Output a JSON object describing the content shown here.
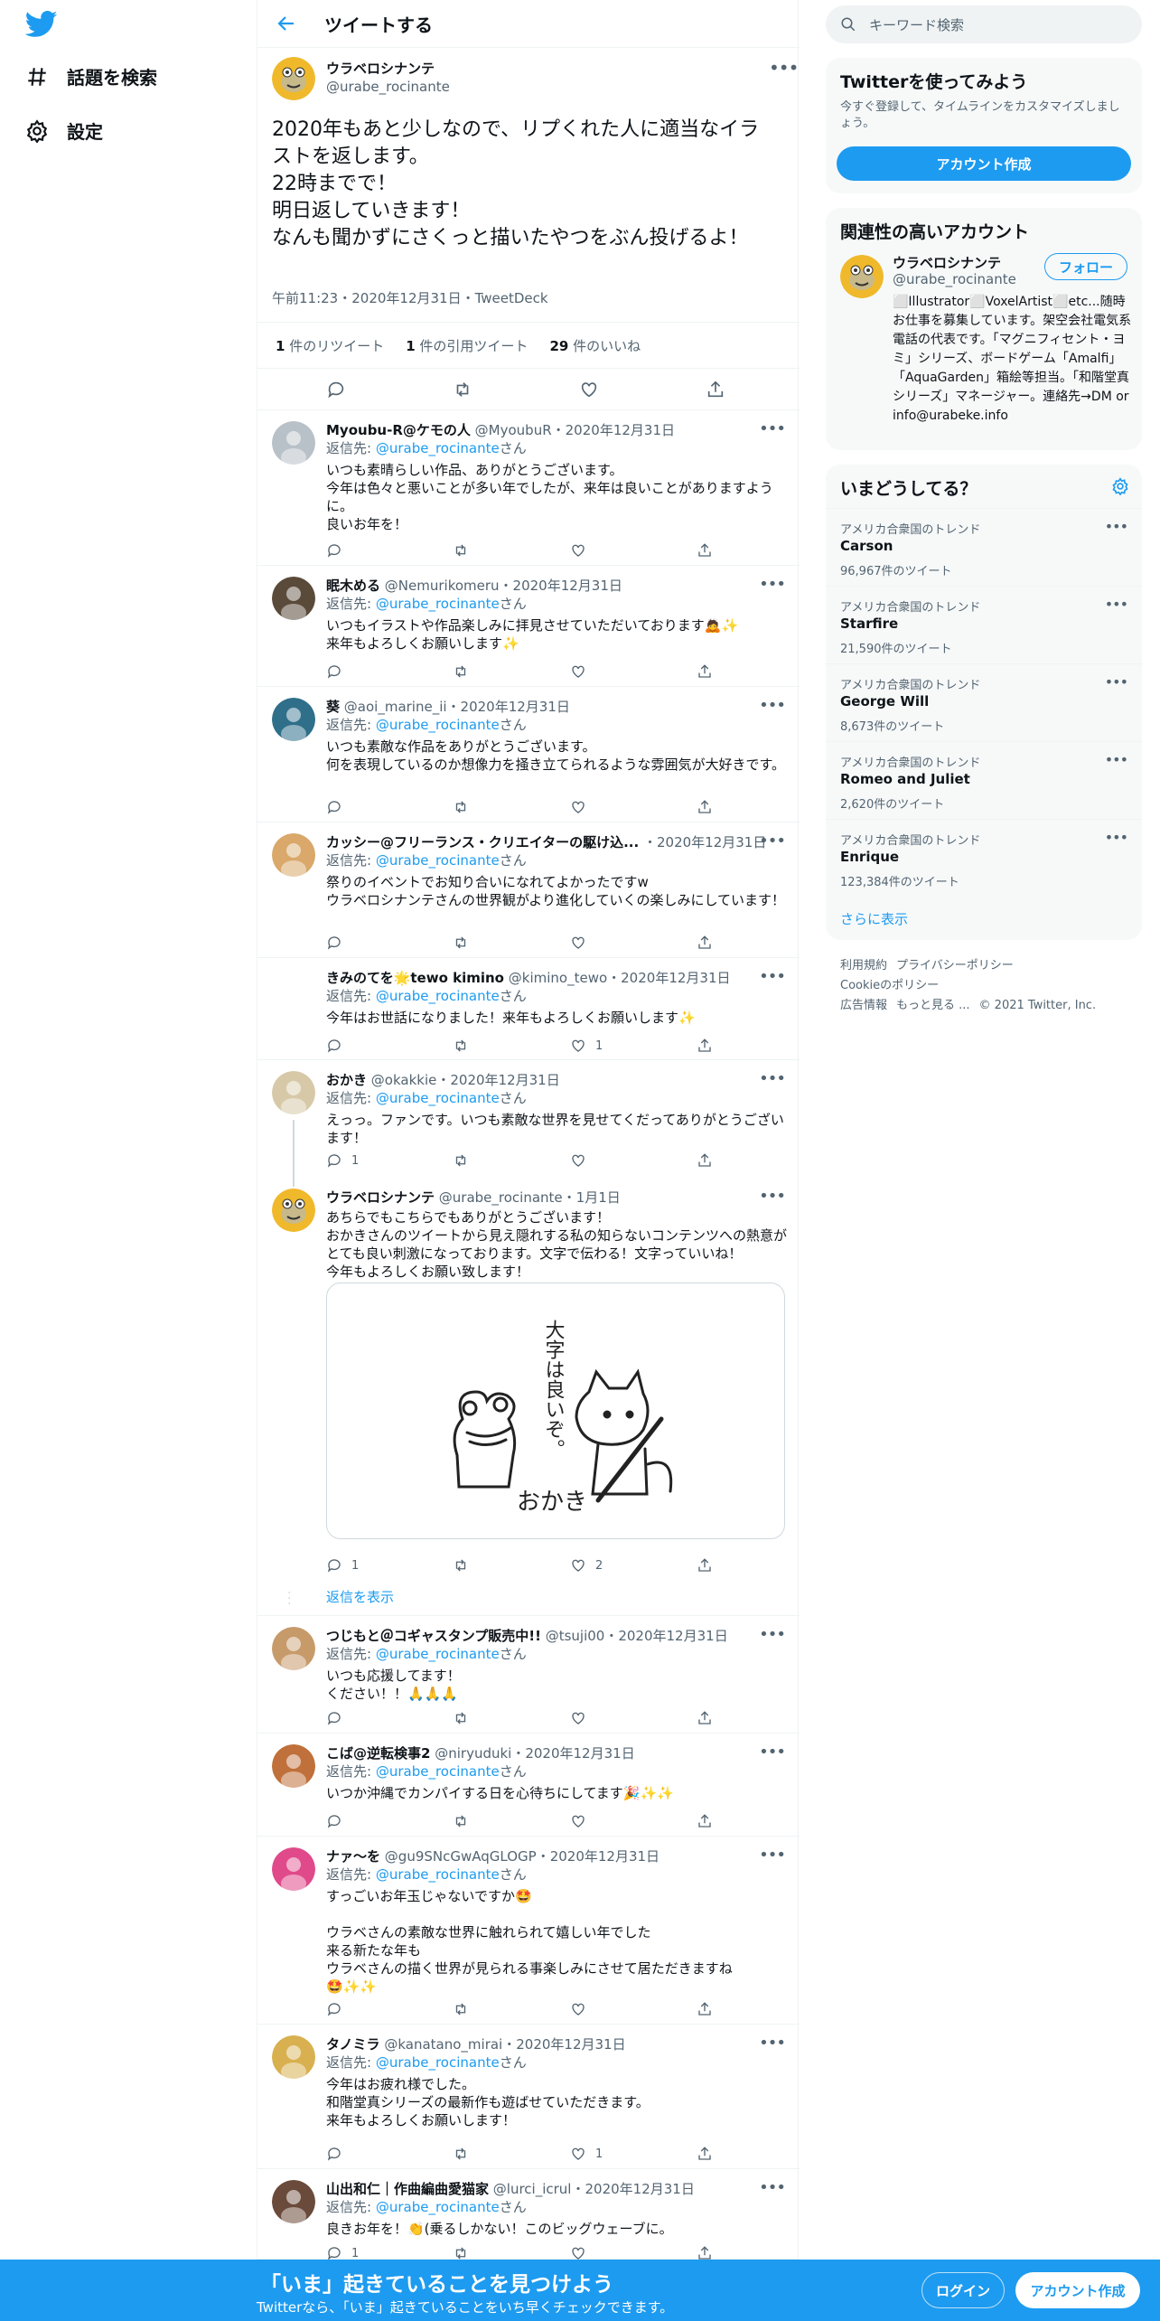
{
  "nav": {
    "explore": "話題を検索",
    "settings": "設定"
  },
  "header": {
    "title": "ツイートする"
  },
  "focus": {
    "name": "ウラベロシナンテ",
    "handle": "@urabe_rocinante",
    "text": "2020年もあと少しなので、リプくれた人に適当なイラストを返します。\n22時までで！\n明日返していきます！\nなんも聞かずにさくっと描いたやつをぶん投げるよ！",
    "meta": "午前11:23・2020年12月31日・TweetDeck",
    "retweets_count": "1",
    "retweets_label": " 件のリツイート",
    "quotes_count": "1",
    "quotes_label": " 件の引用ツイート",
    "likes_count": "29",
    "likes_label": " 件のいいね"
  },
  "reply_to_prefix": "返信先: ",
  "reply_to_suffix": "さん",
  "replies": [
    {
      "name": "Myoubu-R@ケモの人",
      "handle": "@MyoubuR",
      "date": "・2020年12月31日",
      "to": "@urabe_rocinante",
      "text": "いつも素晴らしい作品、ありがとうございます。\n今年は色々と悪いことが多い年でしたが、来年は良いことがありますように。\n良いお年を！",
      "reply_count": "",
      "rt_count": "",
      "like_count": ""
    },
    {
      "name": "眠木める",
      "handle": "@Nemurikomeru",
      "date": "・2020年12月31日",
      "to": "@urabe_rocinante",
      "text": "いつもイラストや作品楽しみに拝見させていただいております🙇✨\n来年もよろしくお願いします✨",
      "reply_count": "",
      "rt_count": "",
      "like_count": ""
    },
    {
      "name": "葵",
      "handle": "@aoi_marine_ii",
      "date": "・2020年12月31日",
      "to": "@urabe_rocinante",
      "text": "いつも素敵な作品をありがとうございます。\n何を表現しているのか想像力を掻き立てられるような雰囲気が大好きです。",
      "reply_count": "",
      "rt_count": "",
      "like_count": ""
    },
    {
      "name": "カッシー@フリーランス・クリエイターの駆け込...",
      "handle": "",
      "date": "・2020年12月31日",
      "to": "@urabe_rocinante",
      "text": "祭りのイベントでお知り合いになれてよかったですw\nウラベロシナンテさんの世界観がより進化していくの楽しみにしています！",
      "reply_count": "",
      "rt_count": "",
      "like_count": ""
    },
    {
      "name": "きみのてを🌟tewo kimino",
      "handle": "@kimino_tewo",
      "date": "・2020年12月31日",
      "to": "@urabe_rocinante",
      "text": "今年はお世話になりました！来年もよろしくお願いします✨",
      "reply_count": "",
      "rt_count": "",
      "like_count": "1"
    },
    {
      "name": "おかき",
      "handle": "@okakkie",
      "date": "・2020年12月31日",
      "to": "@urabe_rocinante",
      "text": "えっっ。ファンです。いつも素敵な世界を見せてくだってありがとうございます！",
      "reply_count": "1",
      "rt_count": "",
      "like_count": ""
    },
    {
      "name": "ウラベロシナンテ",
      "handle": "@urabe_rocinante",
      "date": "・1月1日",
      "to": "",
      "text": "あちらでもこちらでもありがとうございます！\nおかきさんのツイートから見え隠れする私の知らないコンテンツへの熱意がとても良い刺激になっております。文字で伝わる！文字っていいね！\n今年もよろしくお願い致します！",
      "reply_count": "1",
      "rt_count": "",
      "like_count": "2"
    },
    {
      "name": "つじもと＠コギャスタンプ販売中!!",
      "handle": "@tsuji00",
      "date": "・2020年12月31日",
      "to": "@urabe_rocinante",
      "text": "いつも応援してます！\nください！！🙏🙏🙏",
      "reply_count": "",
      "rt_count": "",
      "like_count": ""
    },
    {
      "name": "こば@逆転検事2",
      "handle": "@niryuduki",
      "date": "・2020年12月31日",
      "to": "@urabe_rocinante",
      "text": "いつか沖縄でカンパイする日を心待ちにしてます🎉✨✨",
      "reply_count": "",
      "rt_count": "",
      "like_count": ""
    },
    {
      "name": "ナァ〜を",
      "handle": "@gu9SNcGwAqGLOGP",
      "date": "・2020年12月31日",
      "to": "@urabe_rocinante",
      "text": "すっごいお年玉じゃないですか🤩\n\nウラベさんの素敵な世界に触れられて嬉しい年でした\n来る新たな年も\nウラベさんの描く世界が見られる事楽しみにさせて居ただきますね\n🤩✨✨",
      "reply_count": "",
      "rt_count": "",
      "like_count": ""
    },
    {
      "name": "タノミラ",
      "handle": "@kanatano_mirai",
      "date": "・2020年12月31日",
      "to": "@urabe_rocinante",
      "text": "今年はお疲れ様でした。\n和階堂真シリーズの最新作も遊ばせていただきます。\n来年もよろしくお願いします！",
      "reply_count": "",
      "rt_count": "",
      "like_count": "1"
    },
    {
      "name": "山出和仁｜作曲編曲愛猫家",
      "handle": "@lurci_icrul",
      "date": "・2020年12月31日",
      "to": "@urabe_rocinante",
      "text": "良きお年を！👏(乗るしかない！このビッグウェーブに。",
      "reply_count": "1",
      "rt_count": "",
      "like_count": ""
    }
  ],
  "show_replies": "返信を表示",
  "search": {
    "placeholder": "キーワード検索"
  },
  "join": {
    "title": "Twitterを使ってみよう",
    "sub": "今すぐ登録して、タイムラインをカスタマイズしましょう。",
    "button": "アカウント作成"
  },
  "relevant": {
    "title": "関連性の高いアカウント",
    "name": "ウラベロシナンテ",
    "handle": "@urabe_rocinante",
    "follow": "フォロー",
    "bio": "⬜Illustrator⬜VoxelArtist⬜etc...随時お仕事を募集しています。架空会社電気系電話の代表です。「マグニフィセント・ヨミ」シリーズ、ボードゲーム「Amalfi」「AquaGarden」箱絵等担当。「和階堂真シリーズ」マネージャー。連絡先→DM or info@urabeke.info"
  },
  "trends": {
    "title": "いまどうしてる？",
    "items": [
      {
        "context": "アメリカ合衆国のトレンド",
        "name": "Carson",
        "count": "96,967件のツイート"
      },
      {
        "context": "アメリカ合衆国のトレンド",
        "name": "Starfire",
        "count": "21,590件のツイート"
      },
      {
        "context": "アメリカ合衆国のトレンド",
        "name": "George Will",
        "count": "8,673件のツイート"
      },
      {
        "context": "アメリカ合衆国のトレンド",
        "name": "Romeo and Juliet",
        "count": "2,620件のツイート"
      },
      {
        "context": "アメリカ合衆国のトレンド",
        "name": "Enrique",
        "count": "123,384件のツイート"
      }
    ],
    "more": "さらに表示"
  },
  "footer": {
    "terms": "利用規約",
    "privacy": "プライバシーポリシー",
    "cookie": "Cookieのポリシー",
    "ads": "広告情報",
    "more": "もっと見る ...",
    "copyright": "© 2021 Twitter, Inc."
  },
  "bottombar": {
    "title": "「いま」起きていることを見つけよう",
    "sub": "Twitterなら、「いま」起きていることをいち早くチェックできます。",
    "login": "ログイン",
    "signup": "アカウント作成"
  },
  "media_image": {
    "title_text": "大字は良いぞ。",
    "name_text": "おかき"
  },
  "colors": {
    "accent": "#1d9bf0",
    "text": "#0f1419",
    "muted": "#536471",
    "border": "#eff3f4"
  }
}
